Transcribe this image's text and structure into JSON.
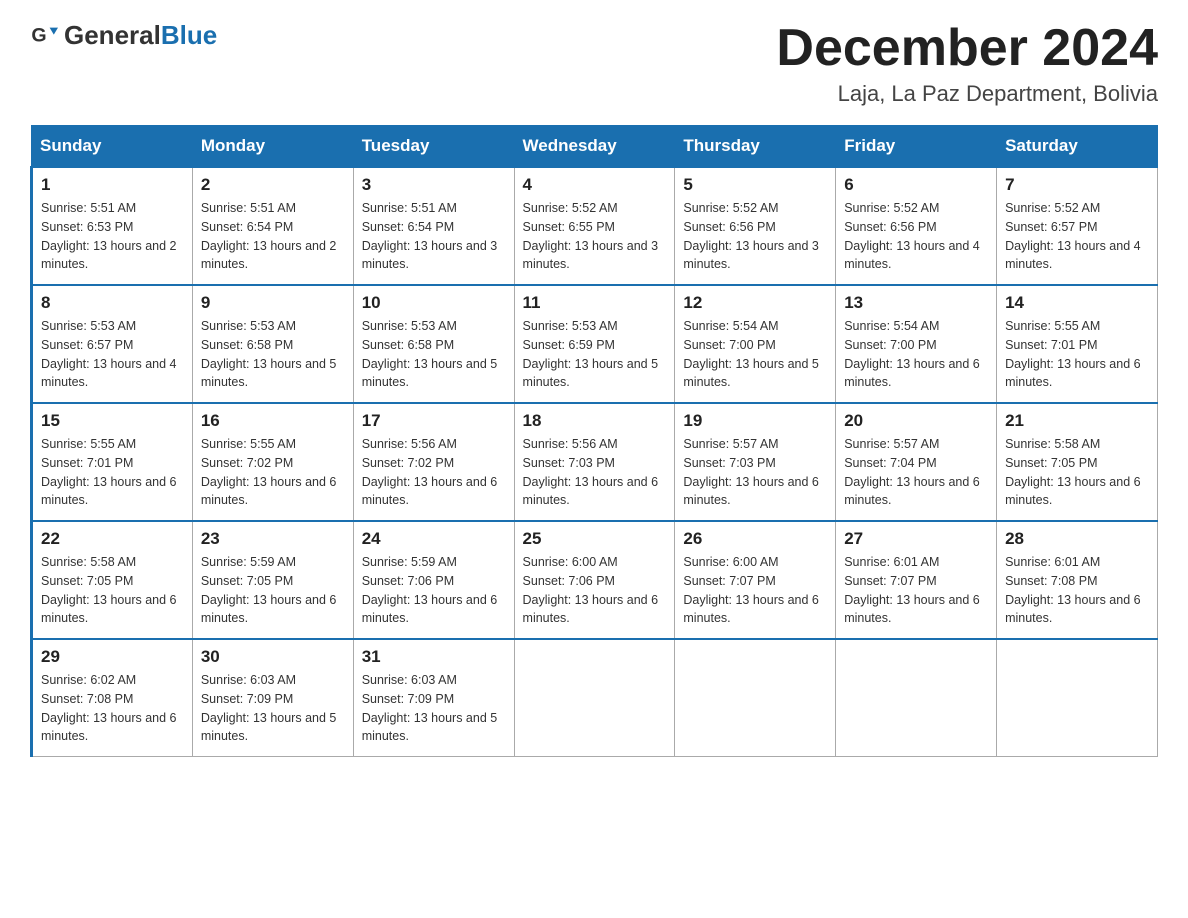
{
  "header": {
    "logo_general": "General",
    "logo_blue": "Blue",
    "month_title": "December 2024",
    "location": "Laja, La Paz Department, Bolivia"
  },
  "days_of_week": [
    "Sunday",
    "Monday",
    "Tuesday",
    "Wednesday",
    "Thursday",
    "Friday",
    "Saturday"
  ],
  "weeks": [
    [
      {
        "day": "1",
        "sunrise": "5:51 AM",
        "sunset": "6:53 PM",
        "daylight": "13 hours and 2 minutes."
      },
      {
        "day": "2",
        "sunrise": "5:51 AM",
        "sunset": "6:54 PM",
        "daylight": "13 hours and 2 minutes."
      },
      {
        "day": "3",
        "sunrise": "5:51 AM",
        "sunset": "6:54 PM",
        "daylight": "13 hours and 3 minutes."
      },
      {
        "day": "4",
        "sunrise": "5:52 AM",
        "sunset": "6:55 PM",
        "daylight": "13 hours and 3 minutes."
      },
      {
        "day": "5",
        "sunrise": "5:52 AM",
        "sunset": "6:56 PM",
        "daylight": "13 hours and 3 minutes."
      },
      {
        "day": "6",
        "sunrise": "5:52 AM",
        "sunset": "6:56 PM",
        "daylight": "13 hours and 4 minutes."
      },
      {
        "day": "7",
        "sunrise": "5:52 AM",
        "sunset": "6:57 PM",
        "daylight": "13 hours and 4 minutes."
      }
    ],
    [
      {
        "day": "8",
        "sunrise": "5:53 AM",
        "sunset": "6:57 PM",
        "daylight": "13 hours and 4 minutes."
      },
      {
        "day": "9",
        "sunrise": "5:53 AM",
        "sunset": "6:58 PM",
        "daylight": "13 hours and 5 minutes."
      },
      {
        "day": "10",
        "sunrise": "5:53 AM",
        "sunset": "6:58 PM",
        "daylight": "13 hours and 5 minutes."
      },
      {
        "day": "11",
        "sunrise": "5:53 AM",
        "sunset": "6:59 PM",
        "daylight": "13 hours and 5 minutes."
      },
      {
        "day": "12",
        "sunrise": "5:54 AM",
        "sunset": "7:00 PM",
        "daylight": "13 hours and 5 minutes."
      },
      {
        "day": "13",
        "sunrise": "5:54 AM",
        "sunset": "7:00 PM",
        "daylight": "13 hours and 6 minutes."
      },
      {
        "day": "14",
        "sunrise": "5:55 AM",
        "sunset": "7:01 PM",
        "daylight": "13 hours and 6 minutes."
      }
    ],
    [
      {
        "day": "15",
        "sunrise": "5:55 AM",
        "sunset": "7:01 PM",
        "daylight": "13 hours and 6 minutes."
      },
      {
        "day": "16",
        "sunrise": "5:55 AM",
        "sunset": "7:02 PM",
        "daylight": "13 hours and 6 minutes."
      },
      {
        "day": "17",
        "sunrise": "5:56 AM",
        "sunset": "7:02 PM",
        "daylight": "13 hours and 6 minutes."
      },
      {
        "day": "18",
        "sunrise": "5:56 AM",
        "sunset": "7:03 PM",
        "daylight": "13 hours and 6 minutes."
      },
      {
        "day": "19",
        "sunrise": "5:57 AM",
        "sunset": "7:03 PM",
        "daylight": "13 hours and 6 minutes."
      },
      {
        "day": "20",
        "sunrise": "5:57 AM",
        "sunset": "7:04 PM",
        "daylight": "13 hours and 6 minutes."
      },
      {
        "day": "21",
        "sunrise": "5:58 AM",
        "sunset": "7:05 PM",
        "daylight": "13 hours and 6 minutes."
      }
    ],
    [
      {
        "day": "22",
        "sunrise": "5:58 AM",
        "sunset": "7:05 PM",
        "daylight": "13 hours and 6 minutes."
      },
      {
        "day": "23",
        "sunrise": "5:59 AM",
        "sunset": "7:05 PM",
        "daylight": "13 hours and 6 minutes."
      },
      {
        "day": "24",
        "sunrise": "5:59 AM",
        "sunset": "7:06 PM",
        "daylight": "13 hours and 6 minutes."
      },
      {
        "day": "25",
        "sunrise": "6:00 AM",
        "sunset": "7:06 PM",
        "daylight": "13 hours and 6 minutes."
      },
      {
        "day": "26",
        "sunrise": "6:00 AM",
        "sunset": "7:07 PM",
        "daylight": "13 hours and 6 minutes."
      },
      {
        "day": "27",
        "sunrise": "6:01 AM",
        "sunset": "7:07 PM",
        "daylight": "13 hours and 6 minutes."
      },
      {
        "day": "28",
        "sunrise": "6:01 AM",
        "sunset": "7:08 PM",
        "daylight": "13 hours and 6 minutes."
      }
    ],
    [
      {
        "day": "29",
        "sunrise": "6:02 AM",
        "sunset": "7:08 PM",
        "daylight": "13 hours and 6 minutes."
      },
      {
        "day": "30",
        "sunrise": "6:03 AM",
        "sunset": "7:09 PM",
        "daylight": "13 hours and 5 minutes."
      },
      {
        "day": "31",
        "sunrise": "6:03 AM",
        "sunset": "7:09 PM",
        "daylight": "13 hours and 5 minutes."
      },
      null,
      null,
      null,
      null
    ]
  ]
}
